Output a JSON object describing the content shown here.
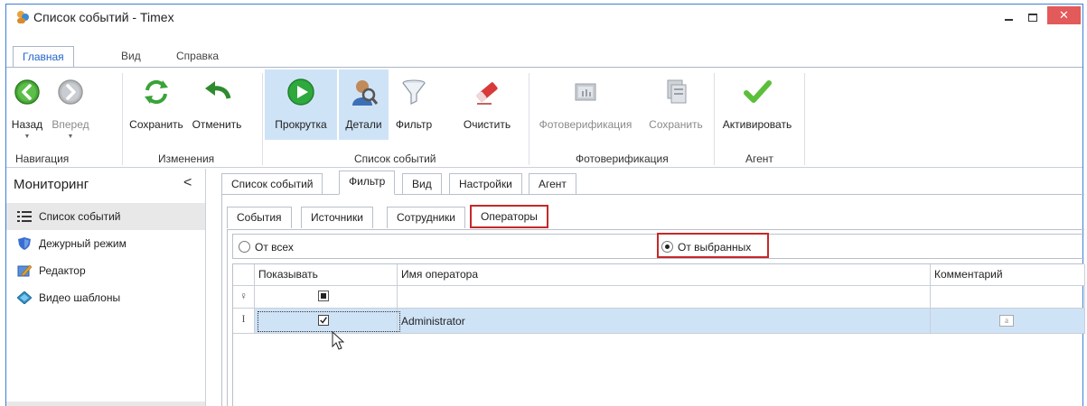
{
  "window": {
    "title": "Список событий - Timex",
    "minimize_glyph": "_",
    "close_glyph": "✕"
  },
  "ribbon": {
    "tabs": [
      "Главная",
      "Вид",
      "Справка"
    ],
    "active_tab": "Главная",
    "groups": [
      {
        "label": "Навигация",
        "buttons": [
          {
            "label": "Назад",
            "icon": "back-arrow-icon",
            "disabled": false
          },
          {
            "label": "Вперед",
            "icon": "forward-arrow-icon",
            "disabled": true
          }
        ]
      },
      {
        "label": "Изменения",
        "buttons": [
          {
            "label": "Сохранить",
            "icon": "refresh-icon",
            "disabled": false
          },
          {
            "label": "Отменить",
            "icon": "undo-icon",
            "disabled": false
          }
        ]
      },
      {
        "label": "Список событий",
        "buttons": [
          {
            "label": "Прокрутка",
            "icon": "play-icon",
            "selected": true
          },
          {
            "label": "Детали",
            "icon": "details-icon",
            "selected": true
          },
          {
            "label": "Фильтр",
            "icon": "filter-icon",
            "selected": false
          },
          {
            "label": "Очистить",
            "icon": "eraser-icon",
            "selected": false
          }
        ]
      },
      {
        "label": "Фотоверификация",
        "buttons": [
          {
            "label": "Фотоверификация",
            "icon": "photo-icon",
            "disabled": true
          },
          {
            "label": "Сохранить",
            "icon": "photo-save-icon",
            "disabled": true
          }
        ]
      },
      {
        "label": "Агент",
        "buttons": [
          {
            "label": "Активировать",
            "icon": "checkmark-icon",
            "disabled": false
          }
        ]
      }
    ]
  },
  "sidebar": {
    "header": "Мониторинг",
    "collapse_glyph": "<",
    "items": [
      {
        "label": "Список событий",
        "icon": "list-icon",
        "active": true
      },
      {
        "label": "Дежурный режим",
        "icon": "shield-icon",
        "active": false
      },
      {
        "label": "Редактор",
        "icon": "editor-icon",
        "active": false
      },
      {
        "label": "Видео шаблоны",
        "icon": "video-template-icon",
        "active": false
      }
    ]
  },
  "main_tabs": [
    "Список событий",
    "Фильтр",
    "Вид",
    "Настройки",
    "Агент"
  ],
  "active_main_tab": "Фильтр",
  "filter_tabs": [
    "События",
    "Источники",
    "Сотрудники",
    "Операторы"
  ],
  "active_filter_tab": "Операторы",
  "radio": {
    "option_all": "От всех",
    "option_selected": "От выбранных",
    "selected": "option_selected"
  },
  "grid": {
    "columns": [
      "Показывать",
      "Имя оператора",
      "Комментарий"
    ],
    "filter_row_glyph": "♀",
    "edit_row_glyph": "I",
    "rows": [
      {
        "show": true,
        "name": "Administrator",
        "comment_glyph": "a"
      }
    ]
  },
  "colors": {
    "accent_blue": "#2266cc",
    "selection": "#cfe3f7",
    "highlight_red": "#c62828",
    "close_button": "#e35a5a"
  }
}
